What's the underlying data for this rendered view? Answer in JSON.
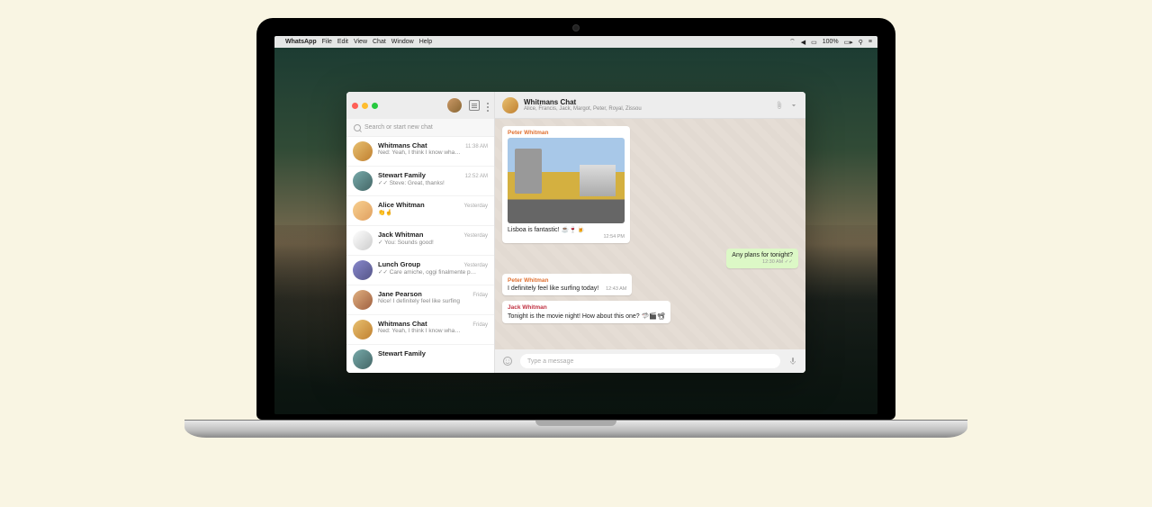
{
  "menubar": {
    "app": "WhatsApp",
    "items": [
      "File",
      "Edit",
      "View",
      "Chat",
      "Window",
      "Help"
    ],
    "battery": "100%"
  },
  "sidebar": {
    "search_placeholder": "Search or start new chat",
    "chats": [
      {
        "name": "Whitmans Chat",
        "preview": "Ned: Yeah, I think I know wha…",
        "time": "11:38 AM"
      },
      {
        "name": "Stewart Family",
        "preview": "✓✓ Steve: Great, thanks!",
        "time": "12:52 AM"
      },
      {
        "name": "Alice Whitman",
        "preview": "👏🤞",
        "time": "Yesterday"
      },
      {
        "name": "Jack Whitman",
        "preview": "✓ You: Sounds good!",
        "time": "Yesterday"
      },
      {
        "name": "Lunch Group",
        "preview": "✓✓ Care amiche, oggi finalmente posso",
        "time": "Yesterday"
      },
      {
        "name": "Jane Pearson",
        "preview": "Nice! I definitely feel like surfing",
        "time": "Friday"
      },
      {
        "name": "Whitmans Chat",
        "preview": "Ned: Yeah, I think I know wha…",
        "time": "Friday"
      },
      {
        "name": "Stewart Family",
        "preview": "",
        "time": ""
      }
    ]
  },
  "chat": {
    "title": "Whitmans Chat",
    "participants": "Alice, Francis, Jack, Margot, Peter, Royal, Zissou",
    "messages": [
      {
        "sender": "Peter Whitman",
        "text": "Lisboa is fantastic! ☕🍷🍺",
        "time": "12:54 PM",
        "type": "in",
        "img": true
      },
      {
        "sender": "",
        "text": "Any plans for tonight?",
        "time": "12:30 AM ✓✓",
        "type": "out"
      },
      {
        "sender": "Peter Whitman",
        "text": "I definitely feel like surfing today!",
        "time": "12:43 AM",
        "type": "in"
      },
      {
        "sender": "Jack Whitman",
        "text": "Tonight is the movie night! How about this one? 🦈🎬📽",
        "time": "",
        "type": "in",
        "alt": true
      }
    ],
    "composer_placeholder": "Type a message"
  }
}
